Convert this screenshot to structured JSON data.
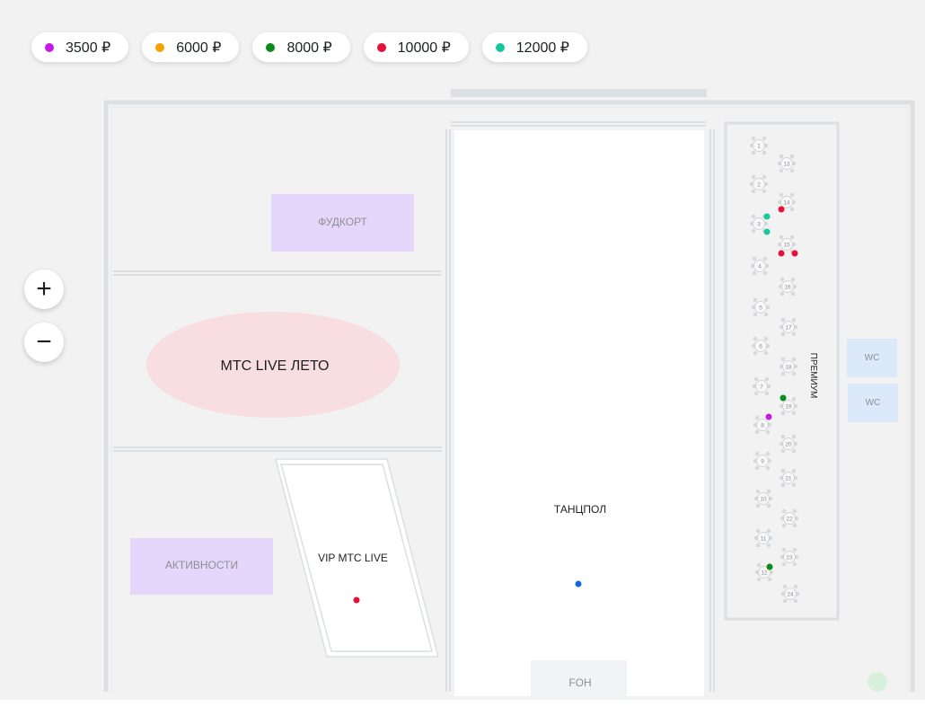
{
  "legend": [
    {
      "label": "3500 ₽",
      "color": "#c41ce6"
    },
    {
      "label": "6000 ₽",
      "color": "#f5a200"
    },
    {
      "label": "8000 ₽",
      "color": "#0c8a1a"
    },
    {
      "label": "10000 ₽",
      "color": "#e6103a"
    },
    {
      "label": "12000 ₽",
      "color": "#18c79c"
    }
  ],
  "zoom": {
    "in_label": "+",
    "out_label": "−"
  },
  "zones": {
    "foodcourt": "ФУДКОРТ",
    "stage": "МТС LIVE ЛЕТО",
    "activities": "АКТИВНОСТИ",
    "vip": "VIP МТС LIVE",
    "dancefloor": "ТАНЦПОЛ",
    "foh": "FOH",
    "premium": "ПРЕМИУМ",
    "wc1": "WC",
    "wc2": "WC"
  },
  "tables": [
    "1",
    "2",
    "3",
    "4",
    "5",
    "6",
    "7",
    "8",
    "9",
    "10",
    "11",
    "12",
    "13",
    "14",
    "15",
    "16",
    "17",
    "18",
    "19",
    "20",
    "21",
    "22",
    "23",
    "24"
  ],
  "seats": [
    {
      "table": "3",
      "color": "#18c79c"
    },
    {
      "table": "3",
      "color": "#18c79c"
    },
    {
      "table": "8",
      "color": "#c41ce6"
    },
    {
      "table": "12",
      "color": "#0c8a1a"
    },
    {
      "table": "14",
      "color": "#e6103a"
    },
    {
      "table": "15",
      "color": "#e6103a"
    },
    {
      "table": "15",
      "color": "#e6103a"
    },
    {
      "table": "19",
      "color": "#0c8a1a"
    },
    {
      "zone": "vip",
      "color": "#e6103a"
    },
    {
      "zone": "dancefloor",
      "color": "#1464e6"
    }
  ]
}
